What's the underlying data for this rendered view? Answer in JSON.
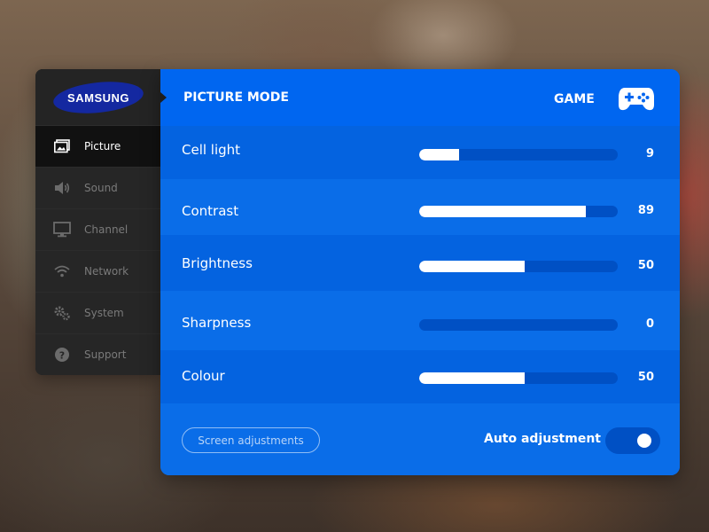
{
  "brand": {
    "logo_text": "SAMSUNG",
    "color": "#1428a0"
  },
  "sidebar": {
    "items": [
      {
        "label": "Picture",
        "icon": "picture-icon",
        "active": true
      },
      {
        "label": "Sound",
        "icon": "speaker-icon",
        "active": false
      },
      {
        "label": "Channel",
        "icon": "monitor-icon",
        "active": false
      },
      {
        "label": "Network",
        "icon": "wifi-icon",
        "active": false
      },
      {
        "label": "System",
        "icon": "gears-icon",
        "active": false
      },
      {
        "label": "Support",
        "icon": "help-icon",
        "active": false
      }
    ]
  },
  "panel": {
    "title": "PICTURE MODE",
    "mode_value": "GAME",
    "mode_icon": "gamepad-icon",
    "accent": "#0a6de8",
    "settings": [
      {
        "label": "Cell light",
        "value": "9",
        "level": 0.2
      },
      {
        "label": "Contrast",
        "value": "89",
        "level": 0.84
      },
      {
        "label": "Brightness",
        "value": "50",
        "level": 0.53
      },
      {
        "label": "Sharpness",
        "value": "0",
        "level": 0
      },
      {
        "label": "Colour",
        "value": "50",
        "level": 0.53
      }
    ]
  },
  "footer": {
    "screen_button": "Screen adjustments",
    "auto_label": "Auto adjustment",
    "auto_enabled": true
  }
}
